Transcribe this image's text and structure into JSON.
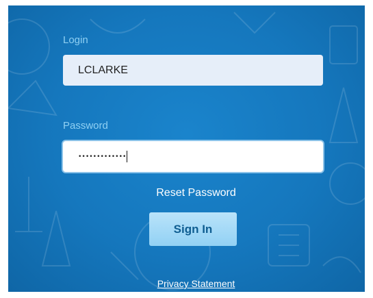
{
  "login": {
    "label": "Login",
    "value": "LCLARKE"
  },
  "password": {
    "label": "Password",
    "masked_value": "•••••••••••••"
  },
  "links": {
    "reset_password": "Reset Password",
    "privacy_statement": "Privacy Statement"
  },
  "actions": {
    "sign_in": "Sign In"
  },
  "colors": {
    "panel_background": "#1577bd",
    "label_text": "#8fd0f3",
    "button_background": "#a6dbf7",
    "button_text": "#0e5d91"
  }
}
